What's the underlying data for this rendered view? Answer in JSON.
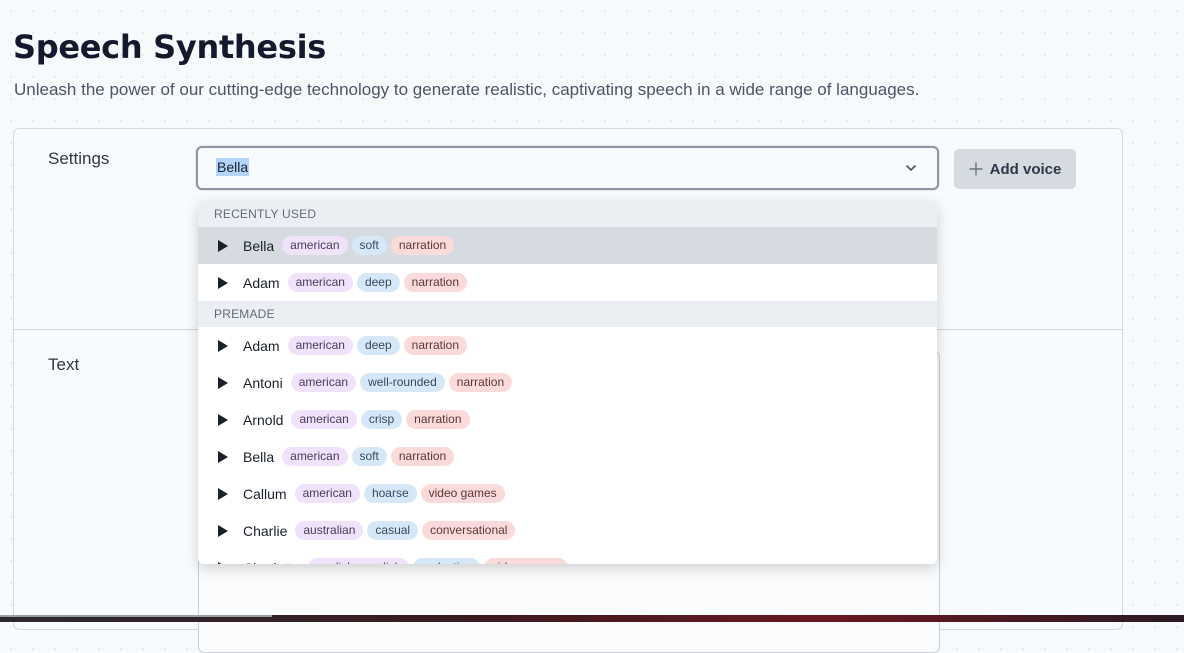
{
  "header": {
    "title": "Speech Synthesis",
    "subtitle": "Unleash the power of our cutting-edge technology to generate realistic, captivating speech in a wide range of languages."
  },
  "settings": {
    "label": "Settings",
    "selected_voice": "Bella",
    "add_voice_label": "Add voice"
  },
  "text_section": {
    "label": "Text"
  },
  "dropdown": {
    "recent_header": "RECENTLY USED",
    "recent": [
      {
        "name": "Bella",
        "accent": "american",
        "age": "soft",
        "use": "narration"
      },
      {
        "name": "Adam",
        "accent": "american",
        "age": "deep",
        "use": "narration"
      }
    ],
    "premade_header": "PREMADE",
    "premade": [
      {
        "name": "Adam",
        "accent": "american",
        "age": "deep",
        "use": "narration"
      },
      {
        "name": "Antoni",
        "accent": "american",
        "age": "well-rounded",
        "use": "narration"
      },
      {
        "name": "Arnold",
        "accent": "american",
        "age": "crisp",
        "use": "narration"
      },
      {
        "name": "Bella",
        "accent": "american",
        "age": "soft",
        "use": "narration"
      },
      {
        "name": "Callum",
        "accent": "american",
        "age": "hoarse",
        "use": "video games"
      },
      {
        "name": "Charlie",
        "accent": "australian",
        "age": "casual",
        "use": "conversational"
      },
      {
        "name": "Charlotte",
        "accent": "english-swedish",
        "age": "seductive",
        "use": "video games"
      }
    ]
  },
  "colors": {
    "accent_tag": "#f0e2fa",
    "descriptor_tag": "#d6e8f8",
    "use_tag": "#fbdada",
    "selected_row": "#d6dbe2"
  }
}
